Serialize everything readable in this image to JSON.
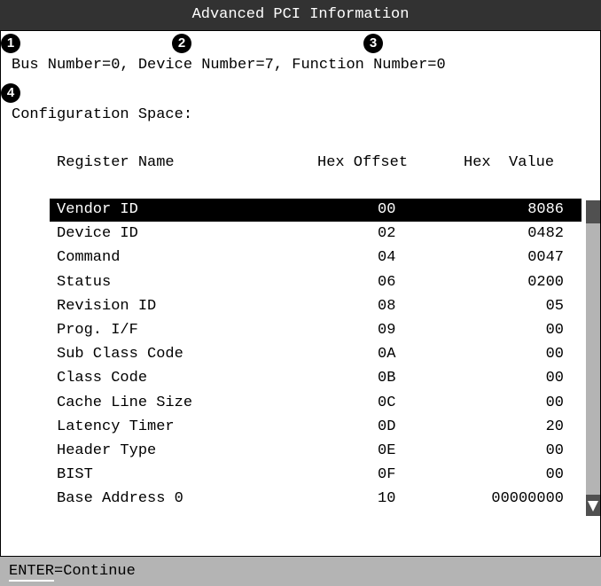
{
  "window": {
    "title": "Advanced PCI Information"
  },
  "callouts": [
    "1",
    "2",
    "3",
    "4"
  ],
  "bus_line": "Bus Number=0, Device Number=7, Function Number=0",
  "config_label": "Configuration Space:",
  "table": {
    "headers": {
      "name": "Register Name",
      "offset": "Hex Offset",
      "value": "Hex  Value"
    },
    "rows": [
      {
        "name": "Vendor ID",
        "offset": "00",
        "value": "8086"
      },
      {
        "name": "Device ID",
        "offset": "02",
        "value": "0482"
      },
      {
        "name": "Command",
        "offset": "04",
        "value": "0047"
      },
      {
        "name": "Status",
        "offset": "06",
        "value": "0200"
      },
      {
        "name": "Revision ID",
        "offset": "08",
        "value": "05"
      },
      {
        "name": "Prog. I/F",
        "offset": "09",
        "value": "00"
      },
      {
        "name": "Sub Class Code",
        "offset": "0A",
        "value": "00"
      },
      {
        "name": "Class Code",
        "offset": "0B",
        "value": "00"
      },
      {
        "name": "Cache Line Size",
        "offset": "0C",
        "value": "00"
      },
      {
        "name": "Latency Timer",
        "offset": "0D",
        "value": "20"
      },
      {
        "name": "Header Type",
        "offset": "0E",
        "value": "00"
      },
      {
        "name": "BIST",
        "offset": "0F",
        "value": "00"
      },
      {
        "name": "Base Address 0",
        "offset": "10",
        "value": "00000000"
      }
    ],
    "selected_index": 0
  },
  "footer": {
    "key": "ENTER",
    "action": "=Continue"
  },
  "colors": {
    "titlebar": "#323232",
    "footer": "#b4b4b4",
    "selection": "#000000",
    "scrollbar": "#b4b4b4"
  }
}
